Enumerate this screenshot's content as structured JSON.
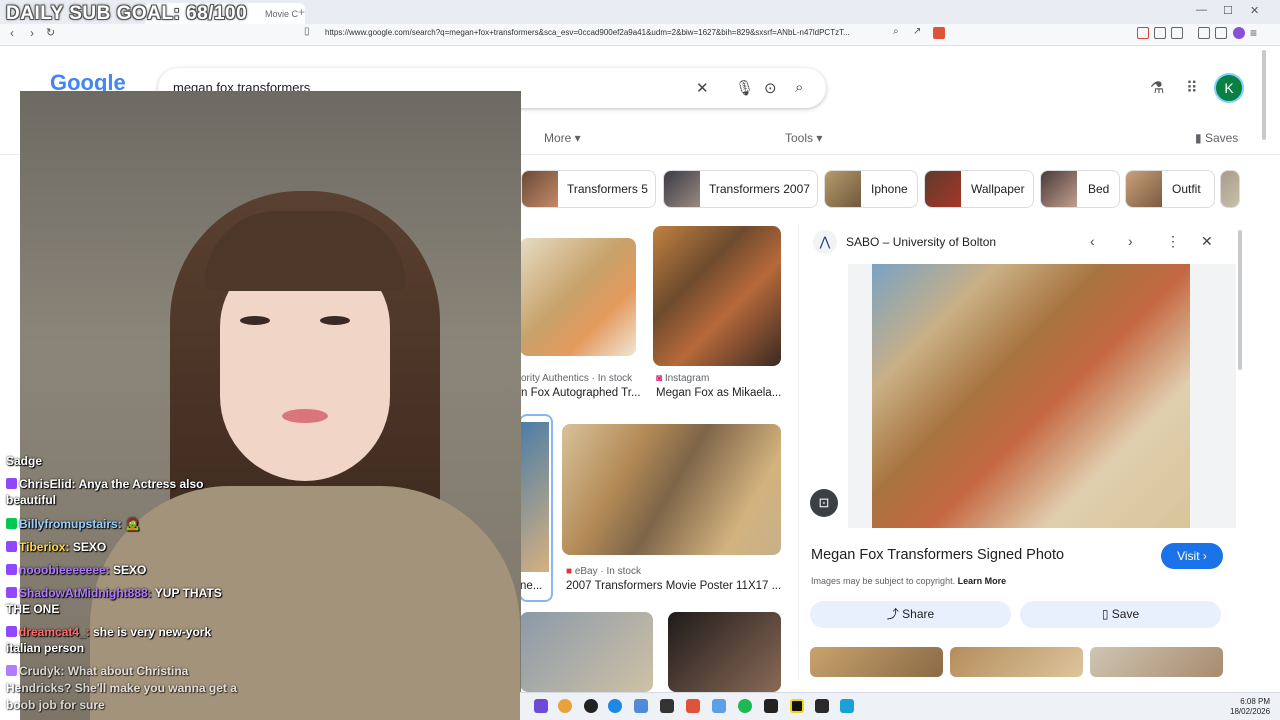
{
  "overlay": {
    "sub_goal": "DAILY SUB GOAL: 68/100"
  },
  "browser": {
    "tab_title": "Movie C",
    "url": "https://www.google.com/search?q=megan+fox+transformers&sca_esv=0ccad900ef2a9a41&udm=2&biw=1627&bih=829&sxsrf=ANbL-n47ldPCTzT..."
  },
  "google": {
    "logo": "Google",
    "query": "megan fox transformers",
    "avatar_letter": "K",
    "tabs": {
      "more": "More",
      "tools": "Tools",
      "saves": "Saves"
    },
    "chips": [
      "Transformers 5",
      "Transformers 2007",
      "Iphone",
      "Wallpaper",
      "Bed",
      "Outfit"
    ],
    "results": [
      {
        "source": "ority Authentics · In stock",
        "title": "n Fox Autographed Tr..."
      },
      {
        "source": "Instagram",
        "title": "Megan Fox as Mikaela..."
      },
      {
        "source": "eBay · In stock",
        "title": "2007 Transformers Movie Poster 11X17 ..."
      }
    ],
    "partial_title": "ne..."
  },
  "preview": {
    "site": "SABO – University of Bolton",
    "title": "Megan Fox Transformers Signed Photo",
    "visit": "Visit",
    "copyright": "Images may be subject to copyright.",
    "learn_more": "Learn More",
    "share": "Share",
    "save": "Save"
  },
  "chat": [
    {
      "user": "Sadge",
      "message": "",
      "color": "#ffffff",
      "badge": false
    },
    {
      "user": "ChrisElid:",
      "message": "Anya the Actress also beautiful",
      "color": "#ffffff",
      "badge": true
    },
    {
      "user": "Billyfromupstairs:",
      "message": "🧟",
      "color": "#9ad1ff",
      "badge": true
    },
    {
      "user": "Tiberiox:",
      "message": "SEXO",
      "color": "#ffd84a",
      "badge": true
    },
    {
      "user": "nooobieeeeeee:",
      "message": "SEXO",
      "color": "#b07cff",
      "badge": true
    },
    {
      "user": "ShadowAtMidnight888:",
      "message": "YUP THATS THE ONE",
      "color": "#b07cff",
      "badge": true
    },
    {
      "user": "dreamcat4_:",
      "message": "she is very new-york italian person",
      "color": "#ff6b6b",
      "badge": true
    },
    {
      "user": "Crudyk:",
      "message": "What about Christina Hendricks? She'll make you wanna get a boob job for sure",
      "color": "#dddddd",
      "badge": true
    }
  ],
  "chat_lines": {
    "l1": "Sadge",
    "l2a": "ChrisElid:",
    "l2b": "Anya the Actress also",
    "l3": "beautiful",
    "l4a": "Billyfromupstairs:",
    "l4b": "🧟",
    "l5a": "Tiberiox:",
    "l5b": "SEXO",
    "l6a": "nooobieeeeeee:",
    "l6b": "SEXO",
    "l7a": "ShadowAtMidnight888:",
    "l7b": "YUP THATS",
    "l8": "THE ONE",
    "l9a": "dreamcat4_:",
    "l9b": "she is very new-york",
    "l10": "italian person",
    "l11a": "Crudyk:",
    "l11b": "What about Christina",
    "l12": "Hendricks? She'll make you wanna get a",
    "l13": "boob job for sure"
  },
  "taskbar": {
    "time": "6:08 PM",
    "date": "18/02/2026"
  }
}
